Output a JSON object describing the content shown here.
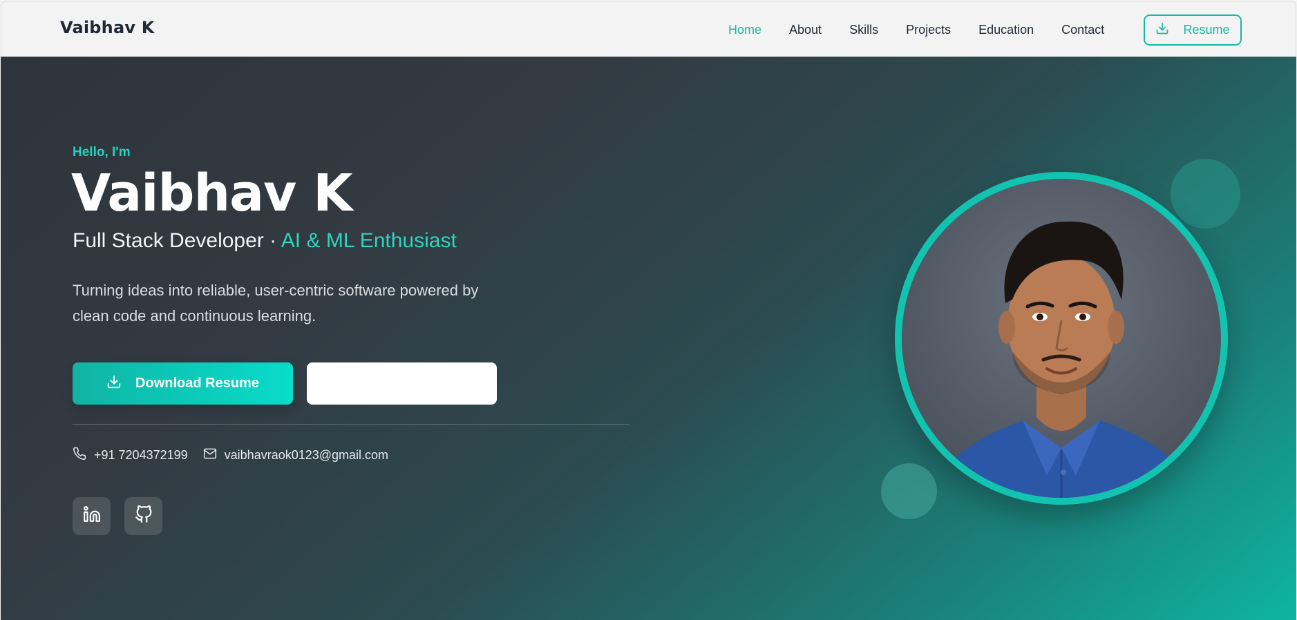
{
  "nav": {
    "brand": "Vaibhav K",
    "links": [
      "Home",
      "About",
      "Skills",
      "Projects",
      "Education",
      "Contact"
    ],
    "active": "Home",
    "resume_label": "Resume"
  },
  "hero": {
    "greeting": "Hello, I'm",
    "name": "Vaibhav K",
    "role_primary": "Full Stack Developer · ",
    "role_accent": "AI & ML Enthusiast",
    "tagline": "Turning ideas into reliable, user-centric software powered by clean code and continuous learning.",
    "download_label": "Download Resume",
    "secondary_label": "",
    "phone": "+91 7204372199",
    "email": "vaibhavraok0123@gmail.com"
  },
  "icons": {
    "download": "download-icon",
    "phone": "phone-icon",
    "email": "mail-icon",
    "linkedin": "linkedin-icon",
    "github": "github-icon"
  },
  "colors": {
    "accent": "#14b8a6",
    "accent_light": "#2dd4bf",
    "hero_dark": "#2e343b",
    "hero_teal": "#0eb5a2"
  }
}
